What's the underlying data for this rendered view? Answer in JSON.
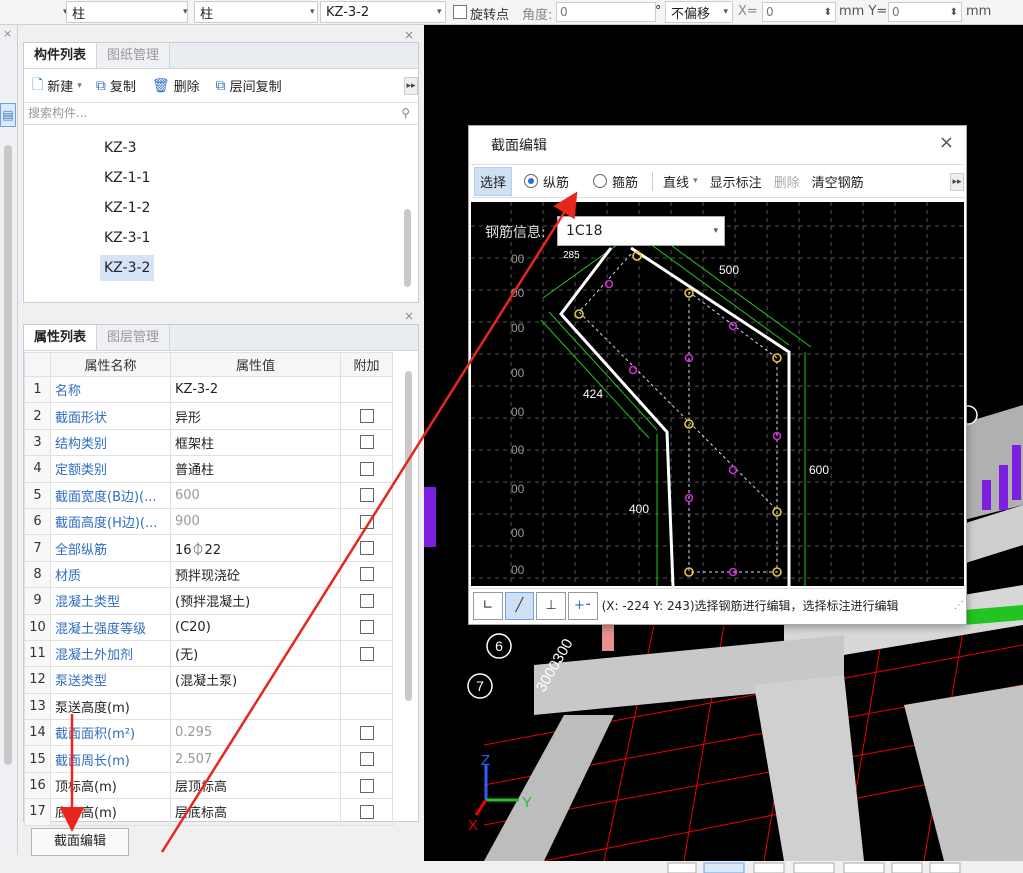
{
  "toolbar": {
    "combo1": "柱",
    "combo2": "柱",
    "combo3": "KZ-3-2",
    "rotate_label": "旋转点",
    "angle_label": "角度:",
    "angle_value": "0",
    "degree": "°",
    "offset_combo": "不偏移",
    "x_label": "X=",
    "x_value": "0",
    "unit_mm_y": "mm Y=",
    "y_value": "0",
    "unit_mm": "mm"
  },
  "component_panel": {
    "tab_active": "构件列表",
    "tab_inactive": "图纸管理",
    "cmd_new": "新建",
    "cmd_copy": "复制",
    "cmd_delete": "删除",
    "cmd_floor_copy": "层间复制",
    "search_placeholder": "搜索构件...",
    "items": [
      "KZ-3",
      "KZ-1-1",
      "KZ-1-2",
      "KZ-3-1",
      "KZ-3-2"
    ]
  },
  "property_panel": {
    "tab_active": "属性列表",
    "tab_inactive": "图层管理",
    "headers": [
      "属性名称",
      "属性值",
      "附加"
    ],
    "rows": [
      {
        "n": "1",
        "name": "名称",
        "value": "KZ-3-2"
      },
      {
        "n": "2",
        "name": "截面形状",
        "value": "异形"
      },
      {
        "n": "3",
        "name": "结构类别",
        "value": "框架柱"
      },
      {
        "n": "4",
        "name": "定额类别",
        "value": "普通柱"
      },
      {
        "n": "5",
        "name": "截面宽度(B边)(...",
        "value": "600"
      },
      {
        "n": "6",
        "name": "截面高度(H边)(...",
        "value": "900"
      },
      {
        "n": "7",
        "name": "全部纵筋",
        "value": "16⏀22"
      },
      {
        "n": "8",
        "name": "材质",
        "value": "预拌现浇砼"
      },
      {
        "n": "9",
        "name": "混凝土类型",
        "value": "(预拌混凝土)"
      },
      {
        "n": "10",
        "name": "混凝土强度等级",
        "value": "(C20)"
      },
      {
        "n": "11",
        "name": "混凝土外加剂",
        "value": "(无)"
      },
      {
        "n": "12",
        "name": "泵送类型",
        "value": "(混凝土泵)"
      },
      {
        "n": "13",
        "name": "泵送高度(m)",
        "value": ""
      },
      {
        "n": "14",
        "name": "截面面积(m²)",
        "value": "0.295"
      },
      {
        "n": "15",
        "name": "截面周长(m)",
        "value": "2.507"
      },
      {
        "n": "16",
        "name": "顶标高(m)",
        "value": "层顶标高"
      },
      {
        "n": "17",
        "name": "底标高(m)",
        "value": "层底标高"
      }
    ],
    "section_edit_button": "截面编辑"
  },
  "dialog": {
    "title": "截面编辑",
    "select": "选择",
    "longitudinal": "纵筋",
    "stirrup": "箍筋",
    "line": "直线",
    "show_dims": "显示标注",
    "delete": "删除",
    "clear_rebar": "清空钢筋",
    "rebar_info_label": "钢筋信息:",
    "rebar_info_value": "1C18",
    "dims": {
      "d500": "500",
      "d424": "424",
      "d400": "400",
      "d600": "600",
      "d285": "285"
    },
    "status_text": "(X: -224 Y: 243)选择钢筋进行编辑，选择标注进行编辑"
  },
  "viewport": {
    "axis_label_6": "6",
    "axis_label_7": "7",
    "dim_text": "3000300",
    "axis_z": "Z",
    "axis_y": "Y",
    "axis_x": "X"
  },
  "colors": {
    "annotation_arrow": "#e8261f",
    "rebar_yellow": "#e8c832",
    "rebar_magenta": "#d02ad0",
    "dim_green": "#22c422"
  }
}
